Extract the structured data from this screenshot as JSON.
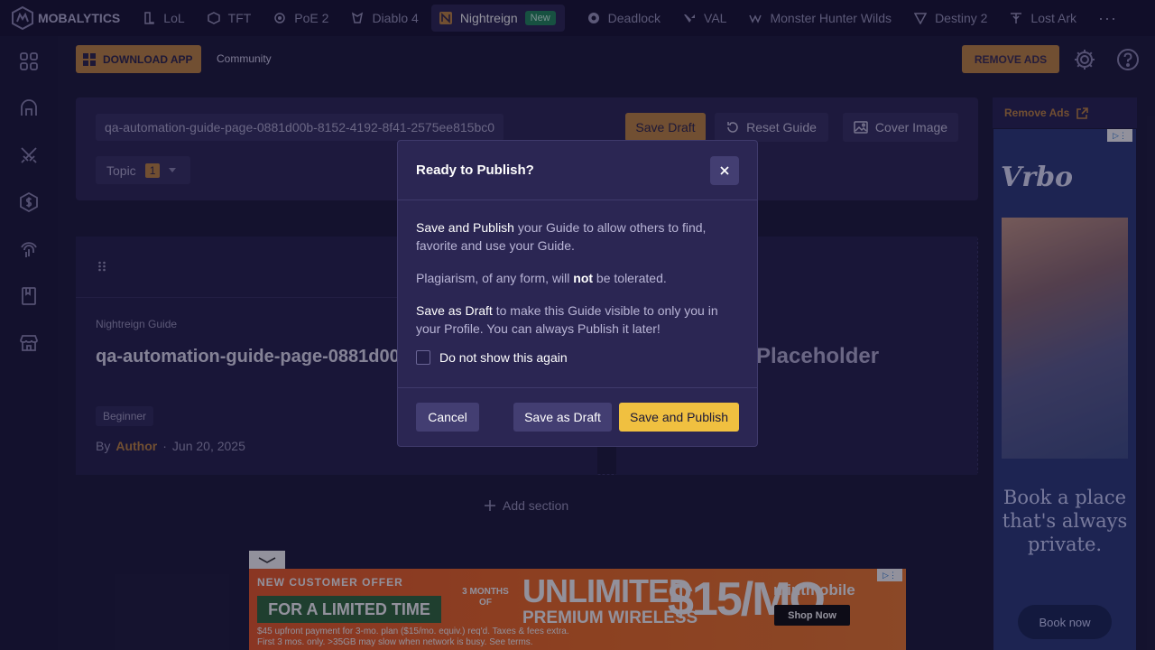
{
  "nav": {
    "brand": "MOBALYTICS",
    "games": [
      {
        "label": "LoL",
        "icon": "lol-icon"
      },
      {
        "label": "TFT",
        "icon": "tft-icon"
      },
      {
        "label": "PoE 2",
        "icon": "poe2-icon"
      },
      {
        "label": "Diablo 4",
        "icon": "diablo4-icon"
      },
      {
        "label": "Nightreign",
        "icon": "nightreign-icon",
        "badge": "New"
      },
      {
        "label": "Deadlock",
        "icon": "deadlock-icon"
      },
      {
        "label": "VAL",
        "icon": "valorant-icon"
      },
      {
        "label": "Monster Hunter Wilds",
        "icon": "mh-wilds-icon"
      },
      {
        "label": "Destiny 2",
        "icon": "destiny2-icon"
      },
      {
        "label": "Lost Ark",
        "icon": "lost-ark-icon"
      }
    ],
    "more": "···"
  },
  "header": {
    "download_label": "DOWNLOAD APP",
    "community_label": "Community",
    "remove_ads_label": "REMOVE ADS"
  },
  "editor": {
    "slug": "qa-automation-guide-page-0881d00b-8152-4192-8f41-2575ee815bc0",
    "save_draft_label": "Save Draft",
    "reset_guide_label": "Reset Guide",
    "cover_image_label": "Cover Image",
    "topic_label": "Topic",
    "topic_count": "1"
  },
  "card": {
    "type": "Nightreign Guide",
    "title": "qa-automation-guide-page-0881d00b-8152-4192-8f41-257",
    "level": "Beginner",
    "by": "By",
    "author": "Author",
    "sep": "·",
    "date": "Jun 20, 2025",
    "placeholder": "Placeholder"
  },
  "add_section_label": "Add section",
  "sidebar_ad": {
    "remove_ads_label": "Remove Ads",
    "brand": "Vrbo",
    "headline": "Book a place that's always private.",
    "cta": "Book now"
  },
  "bottom_ad": {
    "offer": "NEW CUSTOMER OFFER",
    "limited": "FOR A LIMITED TIME",
    "months": "3 MONTHS OF",
    "unlimited": "UNLIMITED",
    "premium": "PREMIUM WIRELESS",
    "price": "$15/MO",
    "brand": "mintmobile",
    "shop": "Shop Now",
    "fine1": "$45 upfront payment for 3-mo. plan ($15/mo. equiv.) req'd. Taxes & fees extra.",
    "fine2": "First 3 mos. only. >35GB may slow when network is busy. See terms."
  },
  "modal": {
    "title": "Ready to Publish?",
    "p1_highlight": "Save and Publish",
    "p1_rest": " your Guide to allow others to find, favorite and use your Guide.",
    "p2_start": "Plagiarism, of any form, will ",
    "p2_bold": "not",
    "p2_end": " be tolerated.",
    "p3_highlight": "Save as Draft",
    "p3_rest": " to make this Guide visible to only you in your Profile. You can always Publish it later!",
    "checkbox_label": "Do not show this again",
    "cancel_label": "Cancel",
    "save_draft_label": "Save as Draft",
    "publish_label": "Save and Publish"
  },
  "colors": {
    "background": "#1b1838",
    "accent_orange": "#c3873f",
    "publish_yellow": "#f0c040",
    "panel": "#2b2653"
  }
}
